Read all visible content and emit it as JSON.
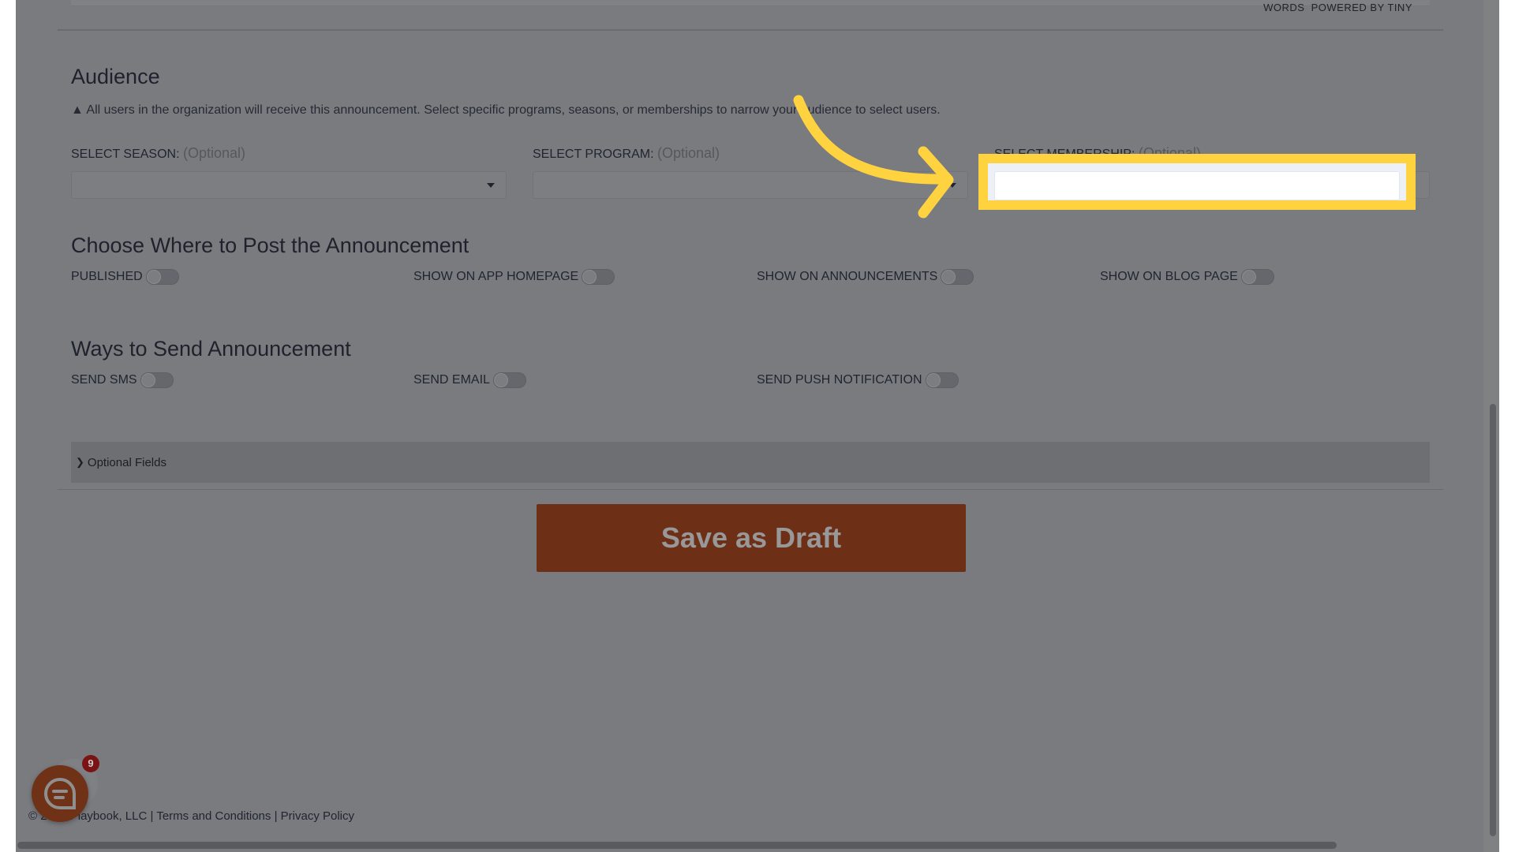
{
  "editor": {
    "status": "WORDS  POWERED BY TINY"
  },
  "audience": {
    "title": "Audience",
    "note": "All users in the organization will receive this announcement. Select specific programs, seasons, or memberships to narrow your audience to select users.",
    "selects": [
      {
        "label": "SELECT SEASON:",
        "optional": "(Optional)",
        "value": ""
      },
      {
        "label": "SELECT PROGRAM:",
        "optional": "(Optional)",
        "value": ""
      },
      {
        "label": "SELECT MEMBERSHIP:",
        "optional": "(Optional)",
        "value": ""
      }
    ]
  },
  "post": {
    "title": "Choose Where to Post the Announcement",
    "toggles": [
      {
        "label": "PUBLISHED",
        "on": false
      },
      {
        "label": "SHOW ON APP HOMEPAGE",
        "on": false
      },
      {
        "label": "SHOW ON ANNOUNCEMENTS",
        "on": false
      },
      {
        "label": "SHOW ON BLOG PAGE",
        "on": false
      }
    ]
  },
  "send": {
    "title": "Ways to Send Announcement",
    "toggles": [
      {
        "label": "SEND SMS",
        "on": false
      },
      {
        "label": "SEND EMAIL",
        "on": false
      },
      {
        "label": "SEND PUSH NOTIFICATION",
        "on": false
      }
    ]
  },
  "optional_fields": {
    "label": "Optional Fields"
  },
  "save_button": {
    "label": "Save as Draft"
  },
  "footer": {
    "copyright": "© 2023 Playbook, LLC",
    "sep": "|",
    "terms": "Terms and Conditions",
    "privacy": "Privacy Policy"
  },
  "chat": {
    "badge": "9"
  },
  "colors": {
    "highlight": "#ffd240",
    "save_button": "#6d2f15",
    "overlay": "#7a7b7f"
  }
}
